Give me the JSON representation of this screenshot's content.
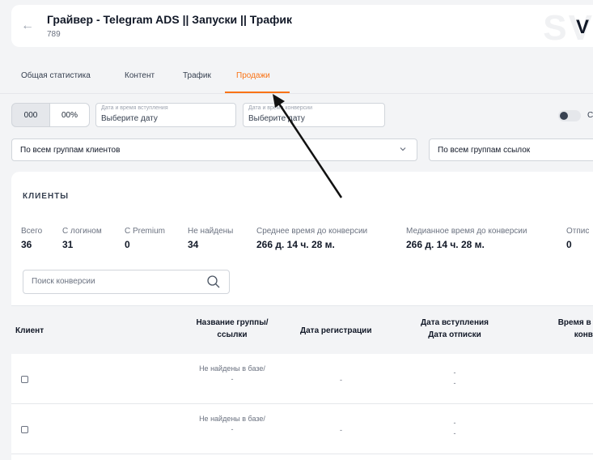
{
  "header": {
    "title": "Грайвер - Telegram ADS || Запуски || Трафик",
    "subtitle": "789",
    "watermark": "SV",
    "brand_letter": "V"
  },
  "tabs": [
    {
      "label": "Общая статистика",
      "active": false
    },
    {
      "label": "Контент",
      "active": false
    },
    {
      "label": "Трафик",
      "active": false
    },
    {
      "label": "Продажи",
      "active": true
    }
  ],
  "filters": {
    "segment_a": "000",
    "segment_b": "00%",
    "date_join": {
      "label": "Дата и время вступления",
      "value": "Выберите дату"
    },
    "date_conversion": {
      "label": "Дата и время конверсии",
      "value": "Выберите дату"
    },
    "toggle_label": "С",
    "client_groups": "По всем группам клиентов",
    "link_groups": "По всем группам ссылок"
  },
  "clients": {
    "title": "КЛИЕНТЫ",
    "stats": [
      {
        "label": "Всего",
        "value": "36"
      },
      {
        "label": "С логином",
        "value": "31"
      },
      {
        "label": "С Premium",
        "value": "0"
      },
      {
        "label": "Не найдены",
        "value": "34"
      },
      {
        "label": "Среднее время до конверсии",
        "value": "266 д. 14 ч. 28 м."
      },
      {
        "label": "Медианное время до конверсии",
        "value": "266 д. 14 ч. 28 м."
      },
      {
        "label": "Отпис",
        "value": "0"
      }
    ],
    "search_placeholder": "Поиск конверсии"
  },
  "table": {
    "headers": {
      "client": "Клиент",
      "group_line1": "Название группы/",
      "group_line2": "ссылки",
      "reg_date": "Дата регистрации",
      "join_line1": "Дата вступления",
      "join_line2": "Дата отписки",
      "time_line1": "Время в кан",
      "time_line2": "конверс"
    },
    "rows": [
      {
        "group_line1": "Не найдены в базе/",
        "group_line2": "-",
        "reg_date": "-",
        "join": "-",
        "leave": "-"
      },
      {
        "group_line1": "Не найдены в базе/",
        "group_line2": "-",
        "reg_date": "-",
        "join": "-",
        "leave": "-"
      }
    ]
  },
  "colors": {
    "accent": "#f97316",
    "background": "#f3f4f6"
  }
}
